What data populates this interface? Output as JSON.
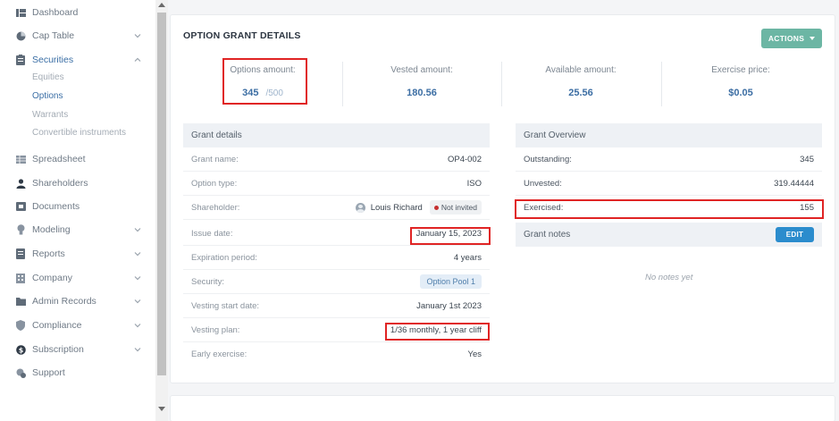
{
  "sidebar": {
    "items": [
      {
        "label": "Dashboard"
      },
      {
        "label": "Cap Table"
      },
      {
        "label": "Securities"
      },
      {
        "label": "Spreadsheet"
      },
      {
        "label": "Shareholders"
      },
      {
        "label": "Documents"
      },
      {
        "label": "Modeling"
      },
      {
        "label": "Reports"
      },
      {
        "label": "Company"
      },
      {
        "label": "Admin Records"
      },
      {
        "label": "Compliance"
      },
      {
        "label": "Subscription"
      },
      {
        "label": "Support"
      }
    ],
    "securities_sub": [
      {
        "label": "Equities"
      },
      {
        "label": "Options"
      },
      {
        "label": "Warrants"
      },
      {
        "label": "Convertible instruments"
      }
    ]
  },
  "card": {
    "title": "OPTION GRANT DETAILS",
    "actions_label": "ACTIONS"
  },
  "stats": {
    "options_amount": {
      "label": "Options amount:",
      "value": "345",
      "total": "/500"
    },
    "vested_amount": {
      "label": "Vested amount:",
      "value": "180.56"
    },
    "available_amount": {
      "label": "Available amount:",
      "value": "25.56"
    },
    "exercise_price": {
      "label": "Exercise price:",
      "value": "$0.05"
    }
  },
  "grant_details": {
    "title": "Grant details",
    "grant_name": {
      "label": "Grant name:",
      "value": "OP4-002"
    },
    "option_type": {
      "label": "Option type:",
      "value": "ISO"
    },
    "shareholder": {
      "label": "Shareholder:",
      "value": "Louis Richard",
      "status": "Not invited"
    },
    "issue_date": {
      "label": "Issue date:",
      "value": "January 15, 2023"
    },
    "expiration_period": {
      "label": "Expiration period:",
      "value": "4 years"
    },
    "security": {
      "label": "Security:",
      "value": "Option Pool 1"
    },
    "vesting_start_date": {
      "label": "Vesting start date:",
      "value": "January 1st 2023"
    },
    "vesting_plan": {
      "label": "Vesting plan:",
      "value": "1/36 monthly, 1 year cliff"
    },
    "early_exercise": {
      "label": "Early exercise:",
      "value": "Yes"
    }
  },
  "grant_overview": {
    "title": "Grant Overview",
    "outstanding": {
      "label": "Outstanding:",
      "value": "345"
    },
    "unvested": {
      "label": "Unvested:",
      "value": "319.44444"
    },
    "exercised": {
      "label": "Exercised:",
      "value": "155"
    }
  },
  "grant_notes": {
    "title": "Grant notes",
    "edit_label": "EDIT",
    "empty_text": "No notes yet"
  },
  "colors": {
    "accent": "#3b6da3",
    "actions_button": "#6cb6a4",
    "edit_button": "#2b8ccd",
    "highlight": "#e02424"
  }
}
